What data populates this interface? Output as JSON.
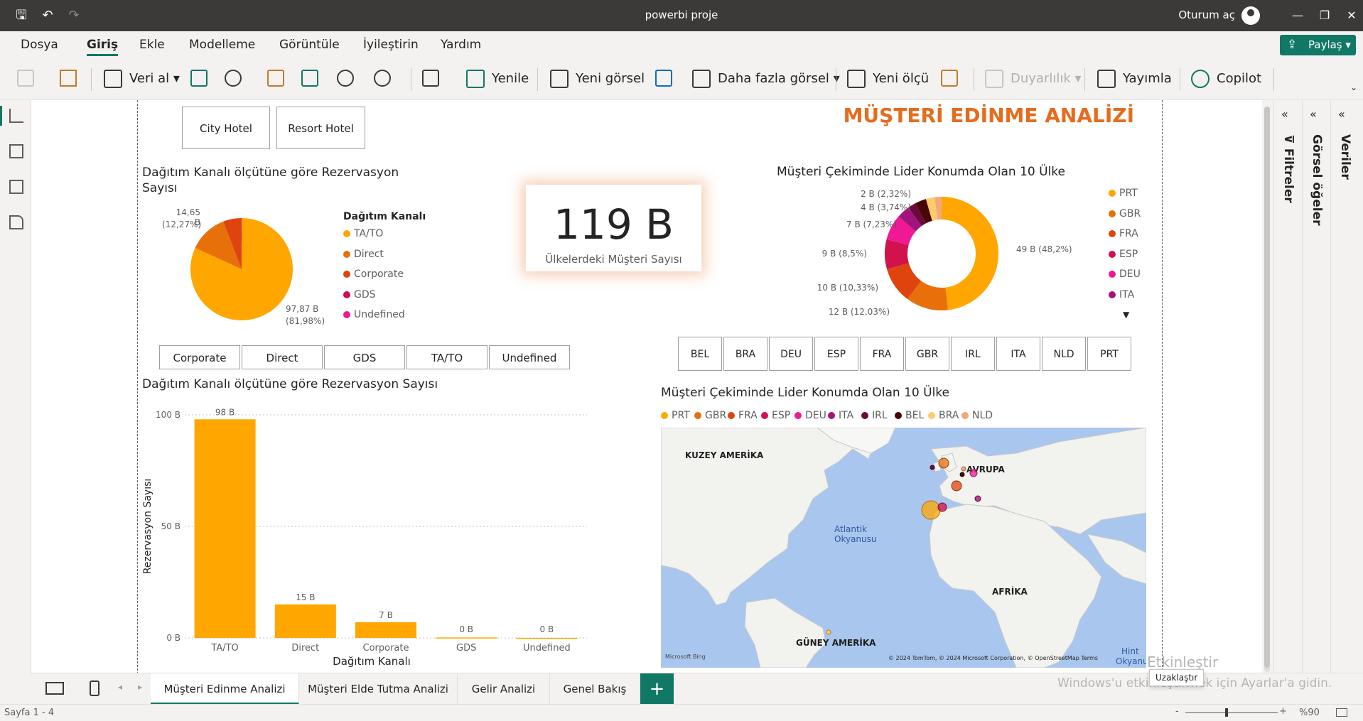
{
  "app": {
    "window_title": "powerbi proje",
    "signin": "Oturum aç"
  },
  "menu": {
    "items": [
      "Dosya",
      "Giriş",
      "Ekle",
      "Modelleme",
      "Görüntüle",
      "İyileştirin",
      "Yardım"
    ],
    "share": "Paylaş"
  },
  "ribbon": {
    "get_data": "Veri al",
    "refresh": "Yenile",
    "new_visual": "Yeni görsel",
    "more_visuals": "Daha fazla görsel",
    "new_measure": "Yeni ölçü",
    "sensitivity": "Duyarlılık",
    "publish": "Yayımla",
    "copilot": "Copilot"
  },
  "report": {
    "title": "MÜŞTERİ EDİNME ANALİZİ",
    "hotel_slicer": [
      "City Hotel",
      "Resort Hotel"
    ],
    "channel_slicer": [
      "Corporate",
      "Direct",
      "GDS",
      "TA/TO",
      "Undefined"
    ],
    "country_slicer": [
      "BEL",
      "BRA",
      "DEU",
      "ESP",
      "FRA",
      "GBR",
      "IRL",
      "ITA",
      "NLD",
      "PRT"
    ],
    "card": {
      "value": "119 B",
      "caption": "Ülkelerdeki Müşteri Sayısı"
    },
    "map": {
      "title": "Müşteri Çekiminde Lider Konumda Olan 10 Ülke",
      "legend": [
        {
          "name": "PRT",
          "color": "#ffa600"
        },
        {
          "name": "GBR",
          "color": "#e8700a"
        },
        {
          "name": "FRA",
          "color": "#e0440e"
        },
        {
          "name": "ESP",
          "color": "#d1124c"
        },
        {
          "name": "DEU",
          "color": "#ef1895"
        },
        {
          "name": "ITA",
          "color": "#a3137c"
        },
        {
          "name": "IRL",
          "color": "#6b0b3c"
        },
        {
          "name": "BEL",
          "color": "#4a0505"
        },
        {
          "name": "BRA",
          "color": "#ffcb6b"
        },
        {
          "name": "NLD",
          "color": "#f2a97a"
        }
      ],
      "labels": {
        "na": "KUZEY AMERİKA",
        "eu": "AVRUPA",
        "af": "AFRİKA",
        "sa": "GÜNEY AMERİKA",
        "ocean1": "Atlantik",
        "ocean2": "Okyanusu",
        "ocean3": "Hint",
        "ocean4": "Okyanusu"
      },
      "attribution": "© 2024 TomTom, © 2024 Microsoft Corporation, © OpenStreetMap  Terms",
      "bing": "Microsoft Bing"
    }
  },
  "chart_data": [
    {
      "type": "pie",
      "title": "Dağıtım Kanalı ölçütüne göre Rezervasyon Sayısı",
      "legend_title": "Dağıtım Kanalı",
      "categories": [
        "TA/TO",
        "Direct",
        "Corporate",
        "GDS",
        "Undefined"
      ],
      "colors": [
        "#ffa600",
        "#e8700a",
        "#e0440e",
        "#d1124c",
        "#ef1895"
      ],
      "values": [
        97.87,
        14.65,
        6.8,
        0.2,
        0.01
      ],
      "data_labels": [
        "97,87 B",
        "(81,98%)",
        "14,65 B",
        "(12,27%)"
      ]
    },
    {
      "type": "pie",
      "title": "Müşteri Çekiminde Lider Konumda Olan 10 Ülke",
      "categories": [
        "PRT",
        "GBR",
        "FRA",
        "ESP",
        "DEU",
        "ITA",
        "IRL",
        "BEL",
        "BRA",
        "NLD"
      ],
      "colors": [
        "#ffa600",
        "#e8700a",
        "#e0440e",
        "#d1124c",
        "#ef1895",
        "#a3137c",
        "#6b0b3c",
        "#4a0505",
        "#ffcb6b",
        "#f2a97a"
      ],
      "values": [
        48.2,
        12.03,
        10.33,
        8.5,
        7.23,
        3.74,
        2.32,
        3.2,
        2.5,
        1.95
      ],
      "legend_visible": [
        "PRT",
        "GBR",
        "FRA",
        "ESP",
        "DEU",
        "ITA"
      ],
      "data_labels": [
        "49 B (48,2%)",
        "12 B (12,03%)",
        "10 B (10,33%)",
        "9 B (8,5%)",
        "7 B (7,23%)",
        "4 B (3,74%)",
        "2 B (2,32%)"
      ]
    },
    {
      "type": "bar",
      "title": "Dağıtım Kanalı ölçütüne göre Rezervasyon Sayısı",
      "xlabel": "Dağıtım Kanalı",
      "ylabel": "Rezervasyon Sayısı",
      "categories": [
        "TA/TO",
        "Direct",
        "Corporate",
        "GDS",
        "Undefined"
      ],
      "values": [
        98,
        15,
        7,
        0.2,
        0.01
      ],
      "value_labels": [
        "98 B",
        "15 B",
        "7 B",
        "0 B",
        "0 B"
      ],
      "yticks": [
        "100 B",
        "50 B",
        "0 B"
      ],
      "ylim": [
        0,
        100
      ],
      "color": "#ffa600"
    }
  ],
  "tabs": [
    "Müşteri Edinme Analizi",
    "Müşteri Elde Tutma Analizi",
    "Gelir Analizi",
    "Genel Bakış"
  ],
  "status": {
    "page": "Sayfa 1 - 4",
    "zoom": "%90",
    "tooltip": "Uzaklaştır",
    "watermark1": "Etkinleştir",
    "watermark2": "Windows'u etkinleştirmek için Ayarlar'a gidin."
  },
  "panes": [
    "Filtreler",
    "Görsel öğeler",
    "Veriler"
  ]
}
